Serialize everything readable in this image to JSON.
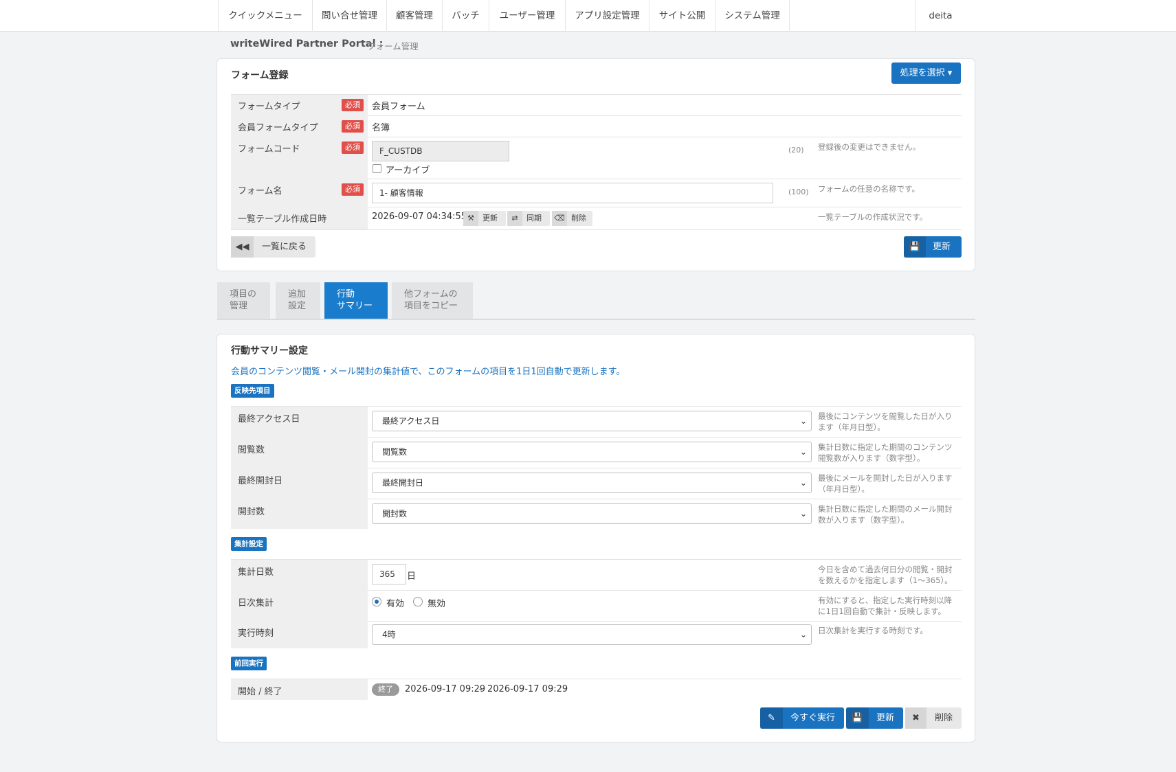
{
  "nav": {
    "items": [
      "クイックメニュー",
      "問い合せ管理",
      "顧客管理",
      "バッチ",
      "ユーザー管理",
      "アプリ設定管理",
      "サイト公開",
      "システム管理"
    ],
    "user": "deita"
  },
  "breadcrumb": {
    "brand": "writeWired Partner Portal :",
    "page": "フォーム管理"
  },
  "form_register": {
    "title": "フォーム登録",
    "action_button": "処理を選択 ▾",
    "required_badge": "必須",
    "rows": {
      "form_type": {
        "label": "フォームタイプ",
        "value": "会員フォーム"
      },
      "member_form_type": {
        "label": "会員フォームタイプ",
        "value": "名簿"
      },
      "form_code": {
        "label": "フォームコード",
        "value": "F_CUSTDB",
        "count": "(20)",
        "help": "登録後の変更はできません。",
        "archive_label": "アーカイブ"
      },
      "form_name": {
        "label": "フォーム名",
        "value": "1- 顧客情報",
        "count": "(100)",
        "help": "フォームの任意の名称です。"
      },
      "table_created": {
        "label": "一覧テーブル作成日時",
        "value": "2026-09-07 04:34:55",
        "update": "更新",
        "sync": "同期",
        "delete": "削除",
        "help": "一覧テーブルの作成状況です。"
      }
    },
    "back_button": "一覧に戻る",
    "update_button": "更新"
  },
  "tabs": [
    {
      "line1": "項目の",
      "line2": "管理"
    },
    {
      "line1": "追加",
      "line2": "設定"
    },
    {
      "line1": "行動",
      "line2": "サマリー"
    },
    {
      "line1": "他フォームの",
      "line2": "項目をコピー"
    }
  ],
  "summary": {
    "title": "行動サマリー設定",
    "description": "会員のコンテンツ閲覧・メール開封の集計値で、このフォームの項目を1日1回自動で更新します。",
    "section_target": "反映先項目",
    "target_rows": [
      {
        "label": "最終アクセス日",
        "select": "最終アクセス日",
        "help1": "最後にコンテンツを閲覧した日が入り",
        "help2": "ます（年月日型）。"
      },
      {
        "label": "閲覧数",
        "select": "閲覧数",
        "help1": "集計日数に指定した期間のコンテンツ",
        "help2": "閲覧数が入ります（数字型）。"
      },
      {
        "label": "最終開封日",
        "select": "最終開封日",
        "help1": "最後にメールを開封した日が入ります",
        "help2": "（年月日型）。"
      },
      {
        "label": "開封数",
        "select": "開封数",
        "help1": "集計日数に指定した期間のメール開封",
        "help2": "数が入ります（数字型）。"
      }
    ],
    "section_agg": "集計設定",
    "agg_days": {
      "label": "集計日数",
      "value": "365",
      "unit": "日",
      "help1": "今日を含めて過去何日分の閲覧・開封",
      "help2": "を数えるかを指定します（1〜365）。"
    },
    "daily": {
      "label": "日次集計",
      "on": "有効",
      "off": "無効",
      "help1": "有効にすると、指定した実行時刻以降",
      "help2": "に1日1回自動で集計・反映します。"
    },
    "run_time": {
      "label": "実行時刻",
      "value": "4時",
      "help": "日次集計を実行する時刻です。"
    },
    "section_last": "前回実行",
    "last_run": {
      "label": "開始 / 終了",
      "status": "終了",
      "start": "2026-09-17 09:29",
      "sep": "-",
      "end": "2026-09-17 09:29"
    },
    "run_now": "今すぐ実行",
    "update": "更新",
    "delete": "削除"
  }
}
